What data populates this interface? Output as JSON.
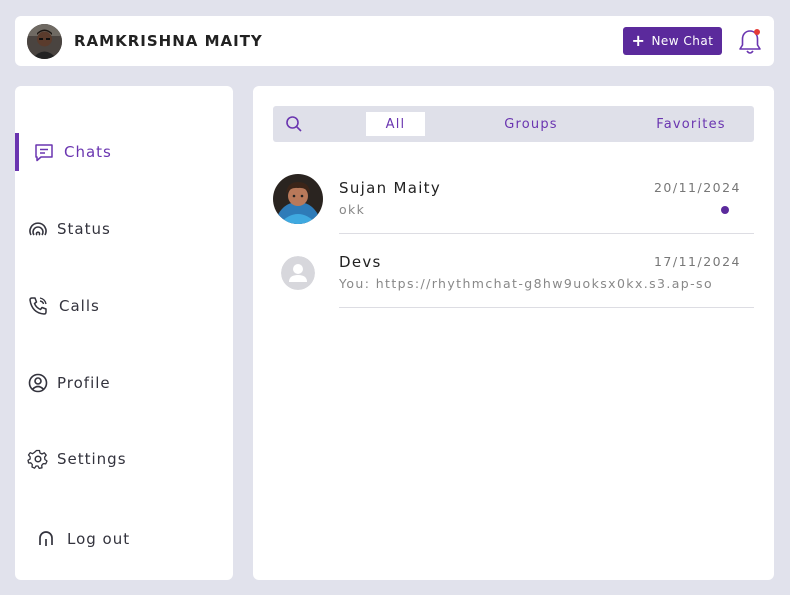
{
  "header": {
    "username": "RAMKRISHNA MAITY",
    "new_chat_label": "New Chat",
    "avatar_icon": "user-avatar-photo",
    "notification_icon": "bell-icon"
  },
  "sidebar": {
    "items": [
      {
        "label": "Chats",
        "icon": "chat-icon",
        "active": true
      },
      {
        "label": "Status",
        "icon": "status-icon"
      },
      {
        "label": "Calls",
        "icon": "phone-icon"
      },
      {
        "label": "Profile",
        "icon": "user-circle-icon"
      },
      {
        "label": "Settings",
        "icon": "gear-icon"
      }
    ],
    "logout_label": "Log out"
  },
  "filters": {
    "tabs": [
      {
        "label": "All",
        "active": true
      },
      {
        "label": "Groups"
      },
      {
        "label": "Favorites"
      }
    ]
  },
  "chats": [
    {
      "name": "Sujan Maity",
      "date": "20/11/2024",
      "preview": "okk",
      "unread": true
    },
    {
      "name": "Devs",
      "date": "17/11/2024",
      "preview": "You: https://rhythmchat-g8hw9uoksx0kx.s3.ap-so",
      "unread": false
    }
  ],
  "colors": {
    "accent": "#5b2a9c",
    "accent_light": "#6a35b0",
    "background": "#e1e2ec",
    "notification_dot": "#e53935"
  }
}
